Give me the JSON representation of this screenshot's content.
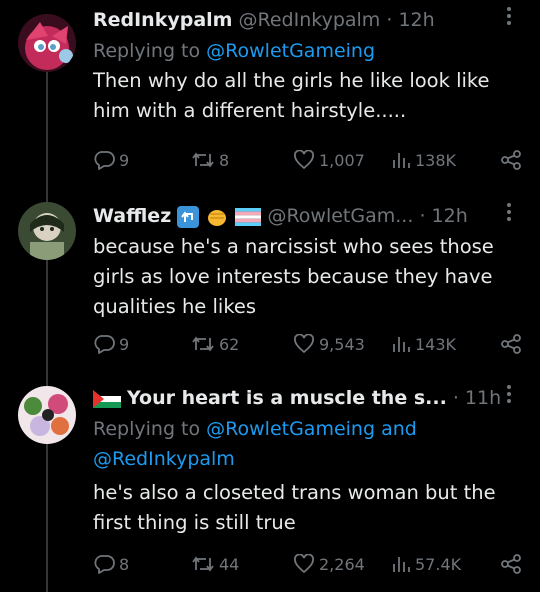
{
  "tweets": [
    {
      "name": "RedInkypalm",
      "handle": "@RedInkypalm",
      "dot": "·",
      "time": "12h",
      "reply_prefix": "Replying to ",
      "reply_mentions": "@RowletGameing",
      "text": "Then why do all the girls he like look like him with a different hairstyle.....",
      "replies": "9",
      "reposts": "8",
      "likes": "1,007",
      "views": "138K",
      "avatar_colors": [
        "#3a0d1e",
        "#c22b5a",
        "#5aa0c8"
      ]
    },
    {
      "name": "Wafflez",
      "handle": "@RowletGam...",
      "dot": "·",
      "time": "12h",
      "text": "because he's a narcissist who sees those girls as love interests because they have qualities he likes",
      "replies": "9",
      "reposts": "62",
      "likes": "9,543",
      "views": "143K",
      "avatar_colors": [
        "#3b4a33",
        "#8a9c78",
        "#1f2a1a"
      ]
    },
    {
      "name": "Your heart is a muscle the s...",
      "dot": "·",
      "time": "11h",
      "reply_prefix": "Replying to ",
      "reply_mentions_1": "@RowletGameing and",
      "reply_mentions_2": "@RedInkypalm",
      "text": "he's also a closeted trans woman but the first thing is still true",
      "replies": "8",
      "reposts": "44",
      "likes": "2,264",
      "views": "57.4K",
      "avatar_colors": [
        "#f1e6ea",
        "#d04a7a",
        "#4a8a3a"
      ]
    }
  ],
  "icons": {
    "more": "more-vertical-icon",
    "reply": "reply-icon",
    "repost": "repost-icon",
    "like": "heart-icon",
    "views": "views-icon",
    "share": "share-icon"
  },
  "colors": {
    "accent": "#1d9bf0",
    "muted": "#71767b",
    "text": "#e7e9ea"
  }
}
